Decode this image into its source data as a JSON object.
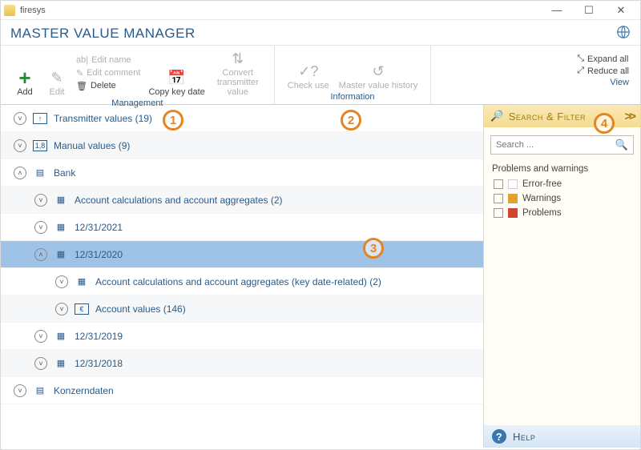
{
  "window": {
    "title": "firesys"
  },
  "header": {
    "title": "MASTER VALUE MANAGER"
  },
  "ribbon": {
    "add": "Add",
    "edit": "Edit",
    "edit_name": "Edit name",
    "edit_comment": "Edit comment",
    "delete": "Delete",
    "copy_key_date": "Copy key date",
    "convert": "Convert transmitter value",
    "check_use": "Check use",
    "history": "Master value history",
    "expand_all": "Expand all",
    "reduce_all": "Reduce all",
    "group_management": "Management",
    "group_information": "Information",
    "group_view": "View"
  },
  "tree": {
    "0": "Transmitter values (19)",
    "1": "Manual values (9)",
    "2": "Bank",
    "3": "Account calculations and account aggregates (2)",
    "4": "12/31/2021",
    "5": "12/31/2020",
    "6": "Account calculations and account aggregates (key date-related) (2)",
    "7": "Account values (146)",
    "8": "12/31/2019",
    "9": "12/31/2018",
    "10": "Konzerndaten"
  },
  "side": {
    "title": "Search & Filter",
    "search_placeholder": "Search ...",
    "problems_title": "Problems and warnings",
    "error_free": "Error-free",
    "warnings": "Warnings",
    "problems": "Problems",
    "help": "Help"
  },
  "annotations": {
    "1": "1",
    "2": "2",
    "3": "3",
    "4": "4"
  }
}
